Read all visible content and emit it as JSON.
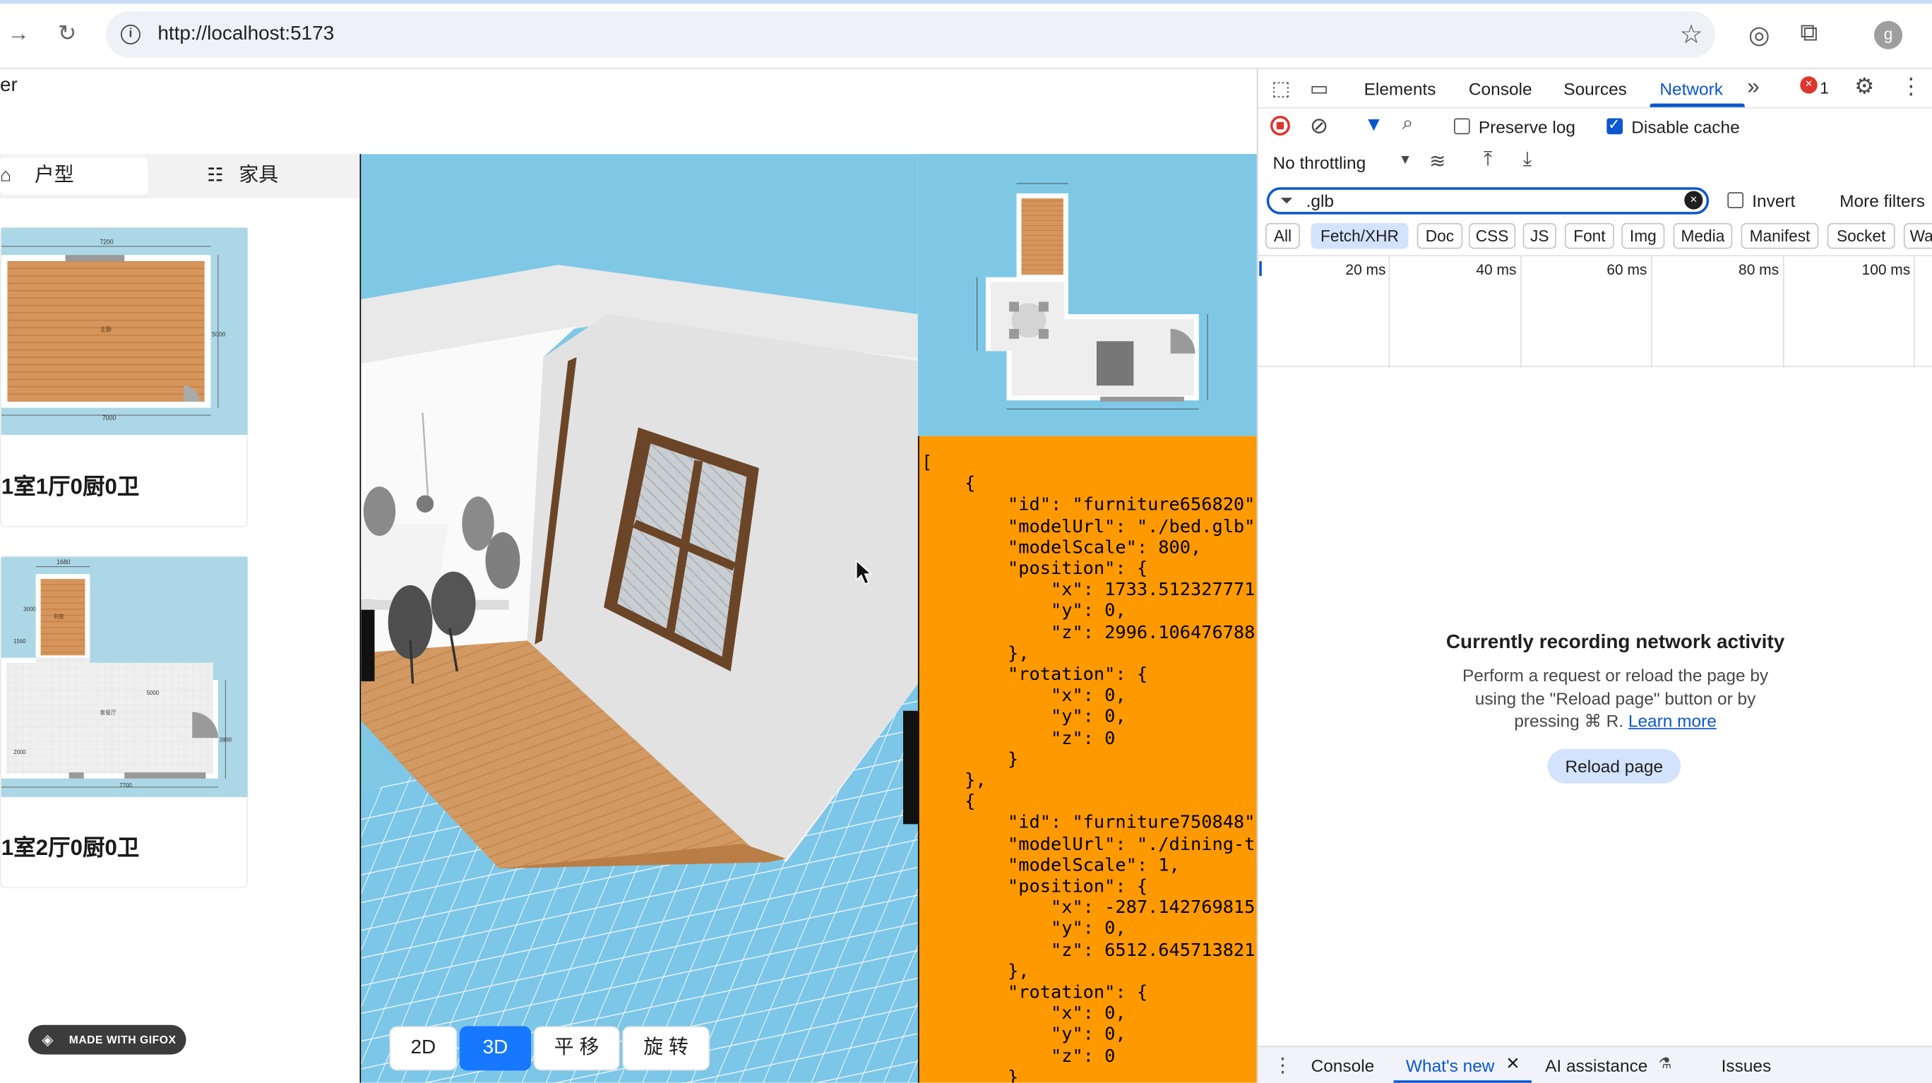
{
  "browser": {
    "url": "http://localhost:5173",
    "avatar_letter": "g"
  },
  "page": {
    "title_fragment": "er",
    "tabs": [
      {
        "label": "户型",
        "icon": "home-icon"
      },
      {
        "label": "家具",
        "icon": "furniture-icon"
      }
    ],
    "floorplans": [
      {
        "name": "1室1厅0厨0卫",
        "dims": {
          "top": "7200",
          "bottom": "7000",
          "right": "5000"
        }
      },
      {
        "name": "1室2厅0厨0卫",
        "dims": {
          "top": "1680",
          "left1": "3000",
          "left2": "1560",
          "left3": "2000",
          "mid": "5000",
          "bottom": "7700",
          "right": "2800"
        }
      }
    ],
    "view_controls": [
      {
        "label": "2D",
        "active": false
      },
      {
        "label": "3D",
        "active": true
      },
      {
        "label": "平 移",
        "active": false
      },
      {
        "label": "旋 转",
        "active": false
      }
    ],
    "json_text": "[\n    {\n        \"id\": \"furniture656820\"\n        \"modelUrl\": \"./bed.glb\"\n        \"modelScale\": 800,\n        \"position\": {\n            \"x\": 1733.512327771\n            \"y\": 0,\n            \"z\": 2996.106476788\n        },\n        \"rotation\": {\n            \"x\": 0,\n            \"y\": 0,\n            \"z\": 0\n        }\n    },\n    {\n        \"id\": \"furniture750848\"\n        \"modelUrl\": \"./dining-t\n        \"modelScale\": 1,\n        \"position\": {\n            \"x\": -287.142769815\n            \"y\": 0,\n            \"z\": 6512.645713821\n        },\n        \"rotation\": {\n            \"x\": 0,\n            \"y\": 0,\n            \"z\": 0\n        }",
    "watermark": "MADE WITH GIFOX"
  },
  "devtools": {
    "tabs": [
      "Elements",
      "Console",
      "Sources",
      "Network"
    ],
    "selected_tab": "Network",
    "error_count": "1",
    "preserve_log": {
      "label": "Preserve log",
      "checked": false
    },
    "disable_cache": {
      "label": "Disable cache",
      "checked": true
    },
    "throttling": "No throttling",
    "filter_value": ".glb",
    "invert": {
      "label": "Invert",
      "checked": false
    },
    "more_filters": "More filters",
    "type_filters": [
      "All",
      "Fetch/XHR",
      "Doc",
      "CSS",
      "JS",
      "Font",
      "Img",
      "Media",
      "Manifest",
      "Socket",
      "Wa"
    ],
    "active_type_filter": "Fetch/XHR",
    "timeline_labels": [
      "20 ms",
      "40 ms",
      "60 ms",
      "80 ms",
      "100 ms"
    ],
    "empty_title": "Currently recording network activity",
    "empty_body": "Perform a request or reload the page by using the \"Reload page\" button or by pressing ⌘ R.",
    "learn_more": "Learn more",
    "reload_button": "Reload page",
    "drawer_tabs": [
      "Console",
      "What's new",
      "AI assistance",
      "Issues"
    ],
    "drawer_selected": "What's new"
  },
  "colors": {
    "accent": "#0b57d0",
    "json_bg": "#ff9900",
    "sky": "#7ec8e6",
    "control_active": "#1677ff"
  }
}
